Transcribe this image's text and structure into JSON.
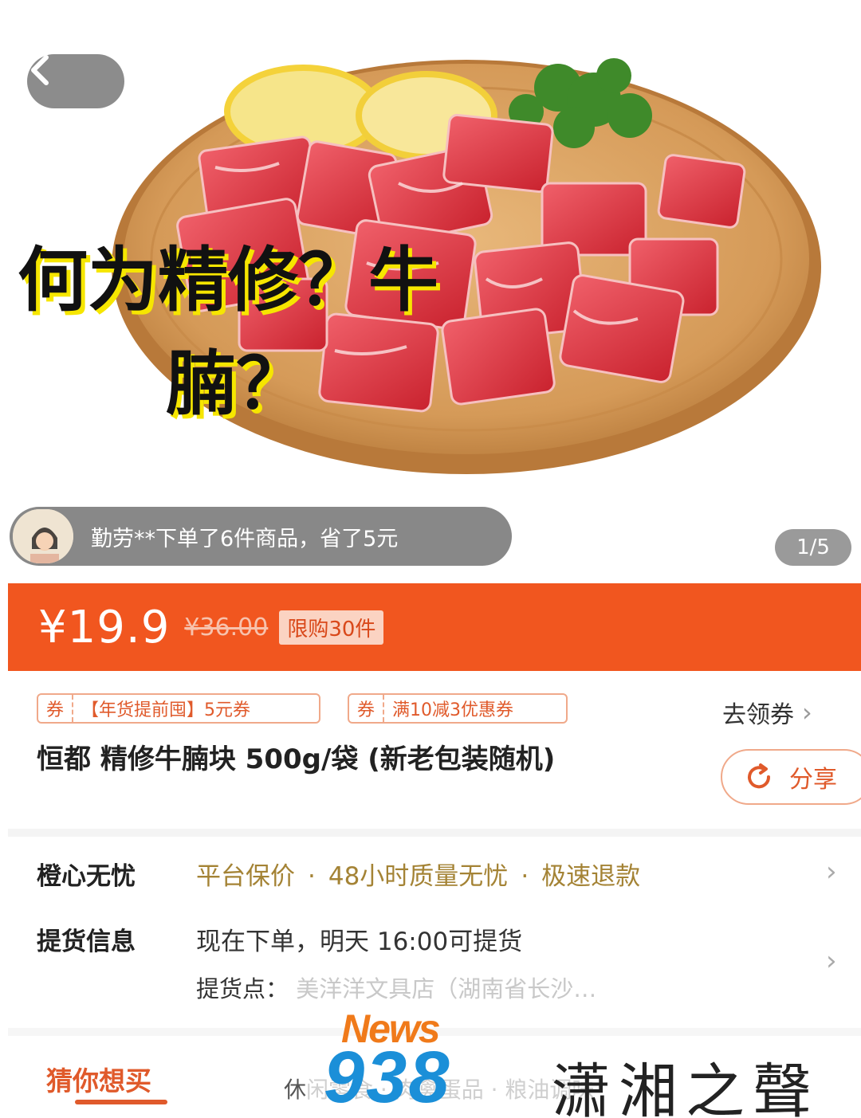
{
  "hero": {
    "overlay_title_line1": "何为精修？牛",
    "overlay_title_line2": "腩？",
    "buyer_notice": "勤劳**下单了6件商品，省了5元",
    "page_indicator": "1/5"
  },
  "price": {
    "current": "¥19.9",
    "original": "¥36.00",
    "limit": "限购30件"
  },
  "coupons": [
    {
      "tag": "券",
      "name": "【年货提前囤】5元券"
    },
    {
      "tag": "券",
      "name": "满10减3优惠券"
    }
  ],
  "get_coupon_label": "去领券",
  "product_title": "恒都 精修牛腩块 500g/袋 (新老包装随机)",
  "share_label": "分享",
  "service": {
    "label": "橙心无忧",
    "items": [
      "平台保价",
      "48小时质量无忧",
      "极速退款"
    ]
  },
  "pickup": {
    "label": "提货信息",
    "time": "现在下单，明天 16:00可提货",
    "point_label": "提货点：",
    "point_value": "美洋洋文具店（湖南省长沙…"
  },
  "tabs": {
    "active": "猜你想买",
    "next_partial": "休",
    "next_faded": "闲零食 · 肉禽蛋品 · 粮油调味"
  },
  "watermark": {
    "news": "News",
    "number": "938",
    "chinese": "潇湘之聲"
  },
  "colors": {
    "accent": "#f1561f",
    "coupon_text": "#e05a2b",
    "service_text": "#a48335"
  }
}
